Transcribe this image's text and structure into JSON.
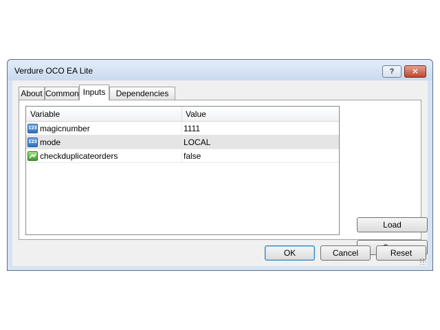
{
  "window": {
    "title": "Verdure OCO EA Lite",
    "help_label": "?",
    "close_label": "✕"
  },
  "tabs": [
    {
      "label": "About"
    },
    {
      "label": "Common"
    },
    {
      "label": "Inputs",
      "active": true
    },
    {
      "label": "Dependencies"
    }
  ],
  "grid": {
    "columns": {
      "variable": "Variable",
      "value": "Value"
    },
    "rows": [
      {
        "icon": "numeric-123-icon",
        "icon_text": "123",
        "variable": "magicnumber",
        "value": "1111"
      },
      {
        "icon": "numeric-123-icon",
        "icon_text": "123",
        "variable": "mode",
        "value": "LOCAL",
        "selected": true
      },
      {
        "icon": "boolean-icon",
        "variable": "checkduplicateorders",
        "value": "false"
      }
    ]
  },
  "side_buttons": {
    "load": "Load",
    "save": "Save"
  },
  "footer_buttons": {
    "ok": "OK",
    "cancel": "Cancel",
    "reset": "Reset"
  }
}
